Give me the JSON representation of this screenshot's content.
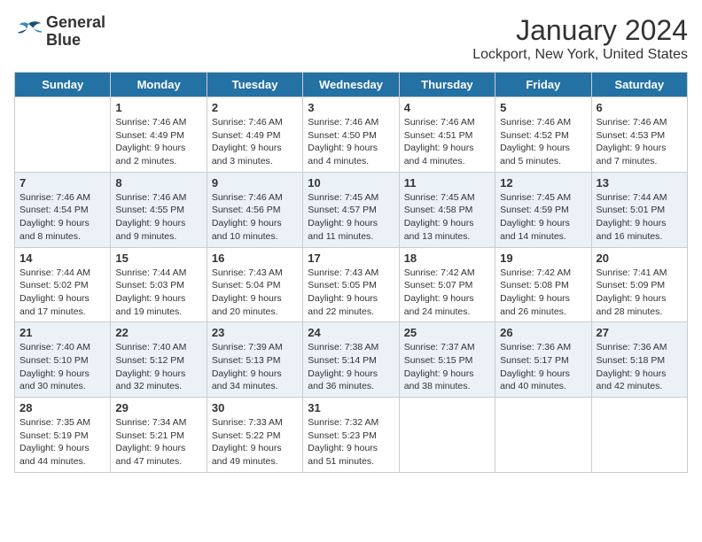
{
  "logo": {
    "line1": "General",
    "line2": "Blue"
  },
  "title": "January 2024",
  "subtitle": "Lockport, New York, United States",
  "days_of_week": [
    "Sunday",
    "Monday",
    "Tuesday",
    "Wednesday",
    "Thursday",
    "Friday",
    "Saturday"
  ],
  "weeks": [
    [
      {
        "day": "",
        "content": ""
      },
      {
        "day": "1",
        "content": "Sunrise: 7:46 AM\nSunset: 4:49 PM\nDaylight: 9 hours\nand 2 minutes."
      },
      {
        "day": "2",
        "content": "Sunrise: 7:46 AM\nSunset: 4:49 PM\nDaylight: 9 hours\nand 3 minutes."
      },
      {
        "day": "3",
        "content": "Sunrise: 7:46 AM\nSunset: 4:50 PM\nDaylight: 9 hours\nand 4 minutes."
      },
      {
        "day": "4",
        "content": "Sunrise: 7:46 AM\nSunset: 4:51 PM\nDaylight: 9 hours\nand 4 minutes."
      },
      {
        "day": "5",
        "content": "Sunrise: 7:46 AM\nSunset: 4:52 PM\nDaylight: 9 hours\nand 5 minutes."
      },
      {
        "day": "6",
        "content": "Sunrise: 7:46 AM\nSunset: 4:53 PM\nDaylight: 9 hours\nand 7 minutes."
      }
    ],
    [
      {
        "day": "7",
        "content": "Sunrise: 7:46 AM\nSunset: 4:54 PM\nDaylight: 9 hours\nand 8 minutes."
      },
      {
        "day": "8",
        "content": "Sunrise: 7:46 AM\nSunset: 4:55 PM\nDaylight: 9 hours\nand 9 minutes."
      },
      {
        "day": "9",
        "content": "Sunrise: 7:46 AM\nSunset: 4:56 PM\nDaylight: 9 hours\nand 10 minutes."
      },
      {
        "day": "10",
        "content": "Sunrise: 7:45 AM\nSunset: 4:57 PM\nDaylight: 9 hours\nand 11 minutes."
      },
      {
        "day": "11",
        "content": "Sunrise: 7:45 AM\nSunset: 4:58 PM\nDaylight: 9 hours\nand 13 minutes."
      },
      {
        "day": "12",
        "content": "Sunrise: 7:45 AM\nSunset: 4:59 PM\nDaylight: 9 hours\nand 14 minutes."
      },
      {
        "day": "13",
        "content": "Sunrise: 7:44 AM\nSunset: 5:01 PM\nDaylight: 9 hours\nand 16 minutes."
      }
    ],
    [
      {
        "day": "14",
        "content": "Sunrise: 7:44 AM\nSunset: 5:02 PM\nDaylight: 9 hours\nand 17 minutes."
      },
      {
        "day": "15",
        "content": "Sunrise: 7:44 AM\nSunset: 5:03 PM\nDaylight: 9 hours\nand 19 minutes."
      },
      {
        "day": "16",
        "content": "Sunrise: 7:43 AM\nSunset: 5:04 PM\nDaylight: 9 hours\nand 20 minutes."
      },
      {
        "day": "17",
        "content": "Sunrise: 7:43 AM\nSunset: 5:05 PM\nDaylight: 9 hours\nand 22 minutes."
      },
      {
        "day": "18",
        "content": "Sunrise: 7:42 AM\nSunset: 5:07 PM\nDaylight: 9 hours\nand 24 minutes."
      },
      {
        "day": "19",
        "content": "Sunrise: 7:42 AM\nSunset: 5:08 PM\nDaylight: 9 hours\nand 26 minutes."
      },
      {
        "day": "20",
        "content": "Sunrise: 7:41 AM\nSunset: 5:09 PM\nDaylight: 9 hours\nand 28 minutes."
      }
    ],
    [
      {
        "day": "21",
        "content": "Sunrise: 7:40 AM\nSunset: 5:10 PM\nDaylight: 9 hours\nand 30 minutes."
      },
      {
        "day": "22",
        "content": "Sunrise: 7:40 AM\nSunset: 5:12 PM\nDaylight: 9 hours\nand 32 minutes."
      },
      {
        "day": "23",
        "content": "Sunrise: 7:39 AM\nSunset: 5:13 PM\nDaylight: 9 hours\nand 34 minutes."
      },
      {
        "day": "24",
        "content": "Sunrise: 7:38 AM\nSunset: 5:14 PM\nDaylight: 9 hours\nand 36 minutes."
      },
      {
        "day": "25",
        "content": "Sunrise: 7:37 AM\nSunset: 5:15 PM\nDaylight: 9 hours\nand 38 minutes."
      },
      {
        "day": "26",
        "content": "Sunrise: 7:36 AM\nSunset: 5:17 PM\nDaylight: 9 hours\nand 40 minutes."
      },
      {
        "day": "27",
        "content": "Sunrise: 7:36 AM\nSunset: 5:18 PM\nDaylight: 9 hours\nand 42 minutes."
      }
    ],
    [
      {
        "day": "28",
        "content": "Sunrise: 7:35 AM\nSunset: 5:19 PM\nDaylight: 9 hours\nand 44 minutes."
      },
      {
        "day": "29",
        "content": "Sunrise: 7:34 AM\nSunset: 5:21 PM\nDaylight: 9 hours\nand 47 minutes."
      },
      {
        "day": "30",
        "content": "Sunrise: 7:33 AM\nSunset: 5:22 PM\nDaylight: 9 hours\nand 49 minutes."
      },
      {
        "day": "31",
        "content": "Sunrise: 7:32 AM\nSunset: 5:23 PM\nDaylight: 9 hours\nand 51 minutes."
      },
      {
        "day": "",
        "content": ""
      },
      {
        "day": "",
        "content": ""
      },
      {
        "day": "",
        "content": ""
      }
    ]
  ]
}
